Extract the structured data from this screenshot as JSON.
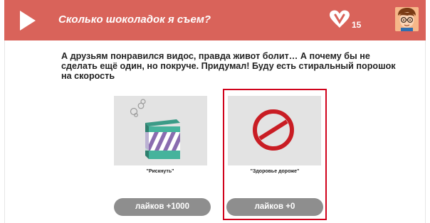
{
  "header": {
    "title": "Сколько шоколадок я съем?",
    "likes_count": "15",
    "play_icon": "play-icon",
    "heart_icon": "heart-icon",
    "avatar": "boy-with-glasses-avatar",
    "background_color": "#d9635a"
  },
  "question": "А друзьям понравился видос, правда живот болит… А почему бы не сделать ещё один, но покруче. Придумал! Буду есть стиральный порошок на скорость",
  "options": [
    {
      "label": "\"Рискнуть\"",
      "button_label": "лайков +1000",
      "image": "detergent-box-icon",
      "selected": false
    },
    {
      "label": "\"Здоровье дороже\"",
      "button_label": "лайков +0",
      "image": "prohibition-sign-icon",
      "selected": true
    }
  ],
  "colors": {
    "selection_border": "#d0021b",
    "button": "#8e8e8e",
    "prohibition": "#c91d24"
  }
}
